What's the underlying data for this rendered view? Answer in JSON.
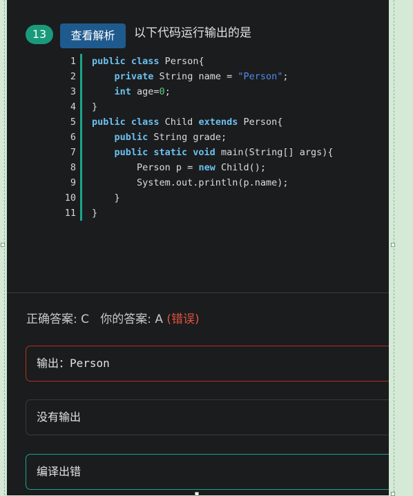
{
  "question": {
    "number": "13",
    "analysis_button": "查看解析",
    "text": "以下代码运行输出的是"
  },
  "code": {
    "lines": [
      {
        "n": "1",
        "tokens": [
          {
            "t": "public class",
            "c": "kw"
          },
          {
            "t": " Person{",
            "c": "src"
          }
        ]
      },
      {
        "n": "2",
        "tokens": [
          {
            "t": "    ",
            "c": "src"
          },
          {
            "t": "private",
            "c": "kw"
          },
          {
            "t": " String name = ",
            "c": "src"
          },
          {
            "t": "\"Person\"",
            "c": "str"
          },
          {
            "t": ";",
            "c": "src"
          }
        ]
      },
      {
        "n": "3",
        "tokens": [
          {
            "t": "    ",
            "c": "src"
          },
          {
            "t": "int",
            "c": "kw"
          },
          {
            "t": " age=",
            "c": "src"
          },
          {
            "t": "0",
            "c": "num"
          },
          {
            "t": ";",
            "c": "src"
          }
        ]
      },
      {
        "n": "4",
        "tokens": [
          {
            "t": "}",
            "c": "src"
          }
        ]
      },
      {
        "n": "5",
        "tokens": [
          {
            "t": "public class",
            "c": "kw"
          },
          {
            "t": " Child ",
            "c": "src"
          },
          {
            "t": "extends",
            "c": "kw"
          },
          {
            "t": " Person{",
            "c": "src"
          }
        ]
      },
      {
        "n": "6",
        "tokens": [
          {
            "t": "    ",
            "c": "src"
          },
          {
            "t": "public",
            "c": "kw"
          },
          {
            "t": " String grade;",
            "c": "src"
          }
        ]
      },
      {
        "n": "7",
        "tokens": [
          {
            "t": "    ",
            "c": "src"
          },
          {
            "t": "public static void",
            "c": "kw"
          },
          {
            "t": " main(String[] args){",
            "c": "src"
          }
        ]
      },
      {
        "n": "8",
        "tokens": [
          {
            "t": "        Person p = ",
            "c": "src"
          },
          {
            "t": "new",
            "c": "kw"
          },
          {
            "t": " Child();",
            "c": "src"
          }
        ]
      },
      {
        "n": "9",
        "tokens": [
          {
            "t": "        System.out.println(p.name);",
            "c": "src"
          }
        ]
      },
      {
        "n": "10",
        "tokens": [
          {
            "t": "    }",
            "c": "src"
          }
        ]
      },
      {
        "n": "11",
        "tokens": [
          {
            "t": "}",
            "c": "src"
          }
        ]
      }
    ]
  },
  "result": {
    "correct_label": "正确答案: C",
    "your_label": "你的答案: A",
    "status": "(错误)"
  },
  "options": [
    {
      "text": "输出：Person"
    },
    {
      "text": "没有输出"
    },
    {
      "text": "编译出错"
    }
  ],
  "colors": {
    "badge": "#1a9a7a",
    "button": "#1f5a8e",
    "wrong": "#e0543f",
    "correct_border": "#1aa58a",
    "wrong_border": "#b3301f"
  }
}
